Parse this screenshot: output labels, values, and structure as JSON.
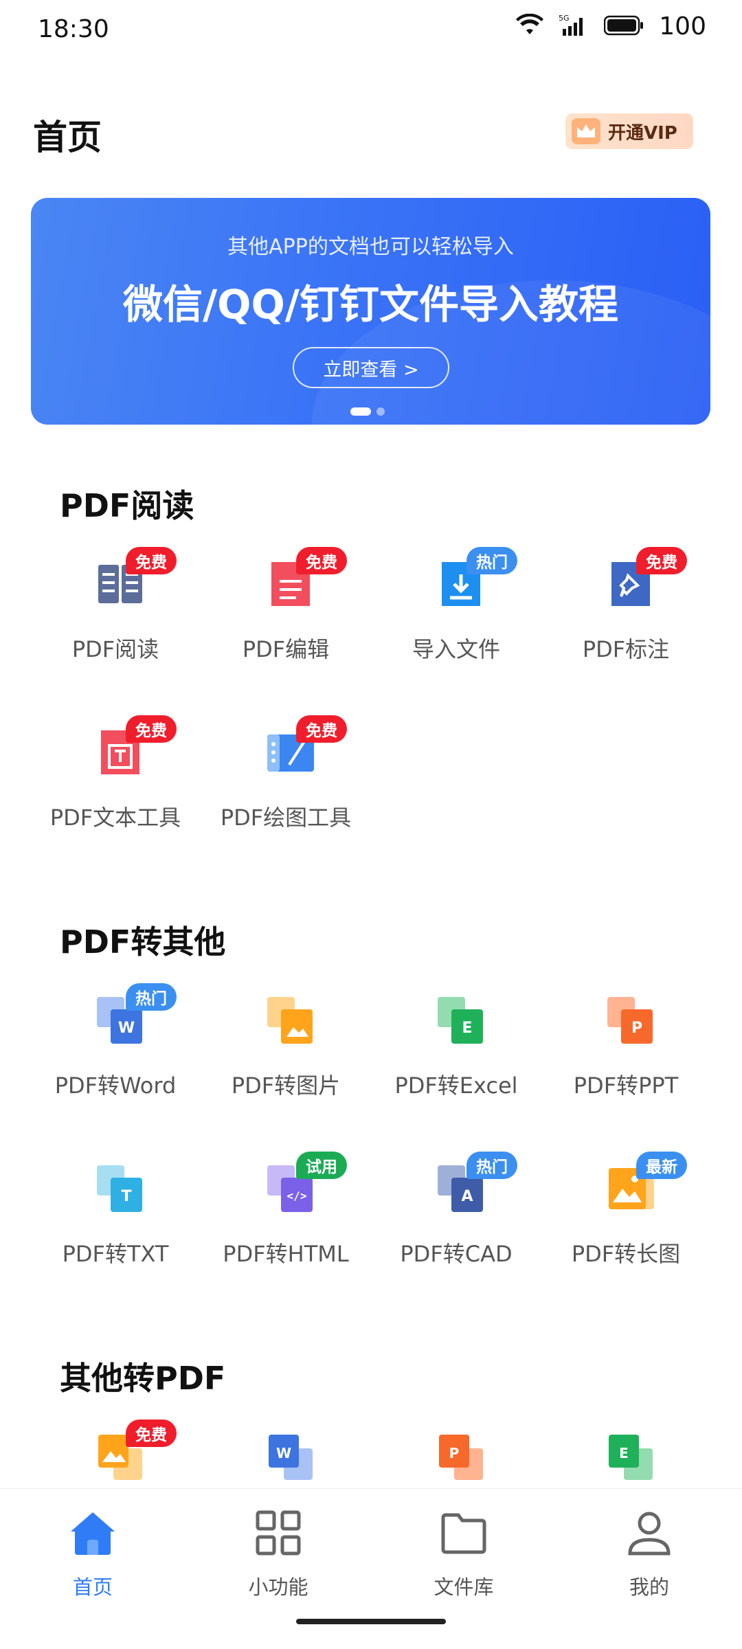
{
  "status_bar": {
    "time": "18:30",
    "battery": "100",
    "network": "5G"
  },
  "header": {
    "title": "首页",
    "vip_label": "开通VIP"
  },
  "banner": {
    "subtitle": "其他APP的文档也可以轻松导入",
    "title": "微信/QQ/钉钉文件导入教程",
    "button_label": "立即查看 >",
    "page_count": 2,
    "active_page": 1
  },
  "sections": [
    {
      "title": "PDF阅读",
      "items": [
        {
          "label": "PDF阅读",
          "badge": "免费",
          "badge_color": "red",
          "icon": "book-icon"
        },
        {
          "label": "PDF编辑",
          "badge": "免费",
          "badge_color": "red",
          "icon": "edit-doc-icon"
        },
        {
          "label": "导入文件",
          "badge": "热门",
          "badge_color": "blue",
          "icon": "import-file-icon"
        },
        {
          "label": "PDF标注",
          "badge": "免费",
          "badge_color": "red",
          "icon": "pin-doc-icon"
        },
        {
          "label": "PDF文本工具",
          "badge": "免费",
          "badge_color": "red",
          "icon": "text-tool-icon"
        },
        {
          "label": "PDF绘图工具",
          "badge": "免费",
          "badge_color": "red",
          "icon": "draw-tool-icon"
        }
      ]
    },
    {
      "title": "PDF转其他",
      "items": [
        {
          "label": "PDF转Word",
          "badge": "热门",
          "badge_color": "blue",
          "icon": "to-word-icon"
        },
        {
          "label": "PDF转图片",
          "badge": "",
          "badge_color": "",
          "icon": "to-image-icon"
        },
        {
          "label": "PDF转Excel",
          "badge": "",
          "badge_color": "",
          "icon": "to-excel-icon"
        },
        {
          "label": "PDF转PPT",
          "badge": "",
          "badge_color": "",
          "icon": "to-ppt-icon"
        },
        {
          "label": "PDF转TXT",
          "badge": "",
          "badge_color": "",
          "icon": "to-txt-icon"
        },
        {
          "label": "PDF转HTML",
          "badge": "试用",
          "badge_color": "green",
          "icon": "to-html-icon"
        },
        {
          "label": "PDF转CAD",
          "badge": "热门",
          "badge_color": "blue",
          "icon": "to-cad-icon"
        },
        {
          "label": "PDF转长图",
          "badge": "最新",
          "badge_color": "blue",
          "icon": "to-long-image-icon"
        }
      ]
    },
    {
      "title": "其他转PDF",
      "items": [
        {
          "label": "",
          "badge": "免费",
          "badge_color": "red",
          "icon": "image-to-pdf-icon"
        },
        {
          "label": "",
          "badge": "",
          "badge_color": "",
          "icon": "word-to-pdf-icon"
        },
        {
          "label": "",
          "badge": "",
          "badge_color": "",
          "icon": "ppt-to-pdf-icon"
        },
        {
          "label": "",
          "badge": "",
          "badge_color": "",
          "icon": "excel-to-pdf-icon"
        }
      ]
    }
  ],
  "bottom_nav": [
    {
      "label": "首页",
      "icon": "home-icon",
      "active": true
    },
    {
      "label": "小功能",
      "icon": "grid-icon",
      "active": false
    },
    {
      "label": "文件库",
      "icon": "folder-icon",
      "active": false
    },
    {
      "label": "我的",
      "icon": "user-icon",
      "active": false
    }
  ],
  "colors": {
    "accent": "#2f7cf6",
    "badge_red": "#f01e2c",
    "badge_blue": "#3b8ff0",
    "badge_green": "#1cab55",
    "banner_blue": "#3a73f6"
  }
}
